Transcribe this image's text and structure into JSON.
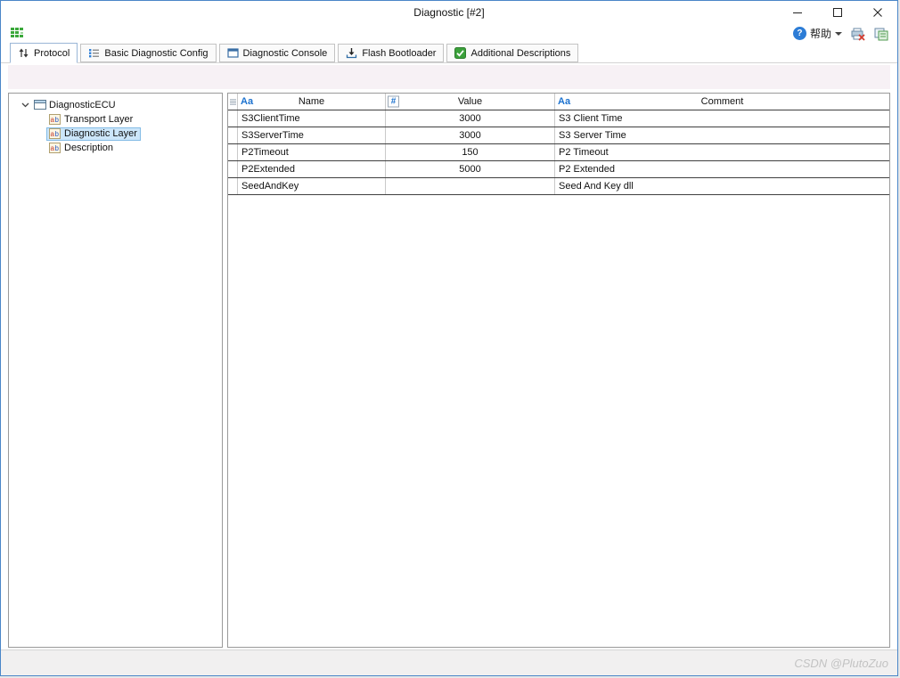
{
  "window": {
    "title": "Diagnostic [#2]"
  },
  "header": {
    "help_glyph": "?",
    "help_label": "帮助"
  },
  "tabs": [
    {
      "label": "Protocol"
    },
    {
      "label": "Basic Diagnostic Config"
    },
    {
      "label": "Diagnostic Console"
    },
    {
      "label": "Flash Bootloader"
    },
    {
      "label": "Additional Descriptions"
    }
  ],
  "tree": {
    "root_label": "DiagnosticECU",
    "items": [
      {
        "label": "Transport Layer"
      },
      {
        "label": "Diagnostic Layer"
      },
      {
        "label": "Description"
      }
    ]
  },
  "table": {
    "columns": [
      {
        "type_marker": "Aa",
        "label": "Name"
      },
      {
        "type_marker": "#",
        "label": "Value"
      },
      {
        "type_marker": "Aa",
        "label": "Comment"
      }
    ],
    "rows": [
      {
        "name": "S3ClientTime",
        "value": "3000",
        "comment": "S3 Client Time"
      },
      {
        "name": "S3ServerTime",
        "value": "3000",
        "comment": "S3 Server Time"
      },
      {
        "name": "P2Timeout",
        "value": "150",
        "comment": "P2 Timeout"
      },
      {
        "name": "P2Extended",
        "value": "5000",
        "comment": "P2 Extended"
      },
      {
        "name": "SeedAndKey",
        "value": "",
        "comment": "Seed And Key dll"
      }
    ]
  },
  "statusbar": {
    "watermark": "CSDN @PlutoZuo"
  }
}
